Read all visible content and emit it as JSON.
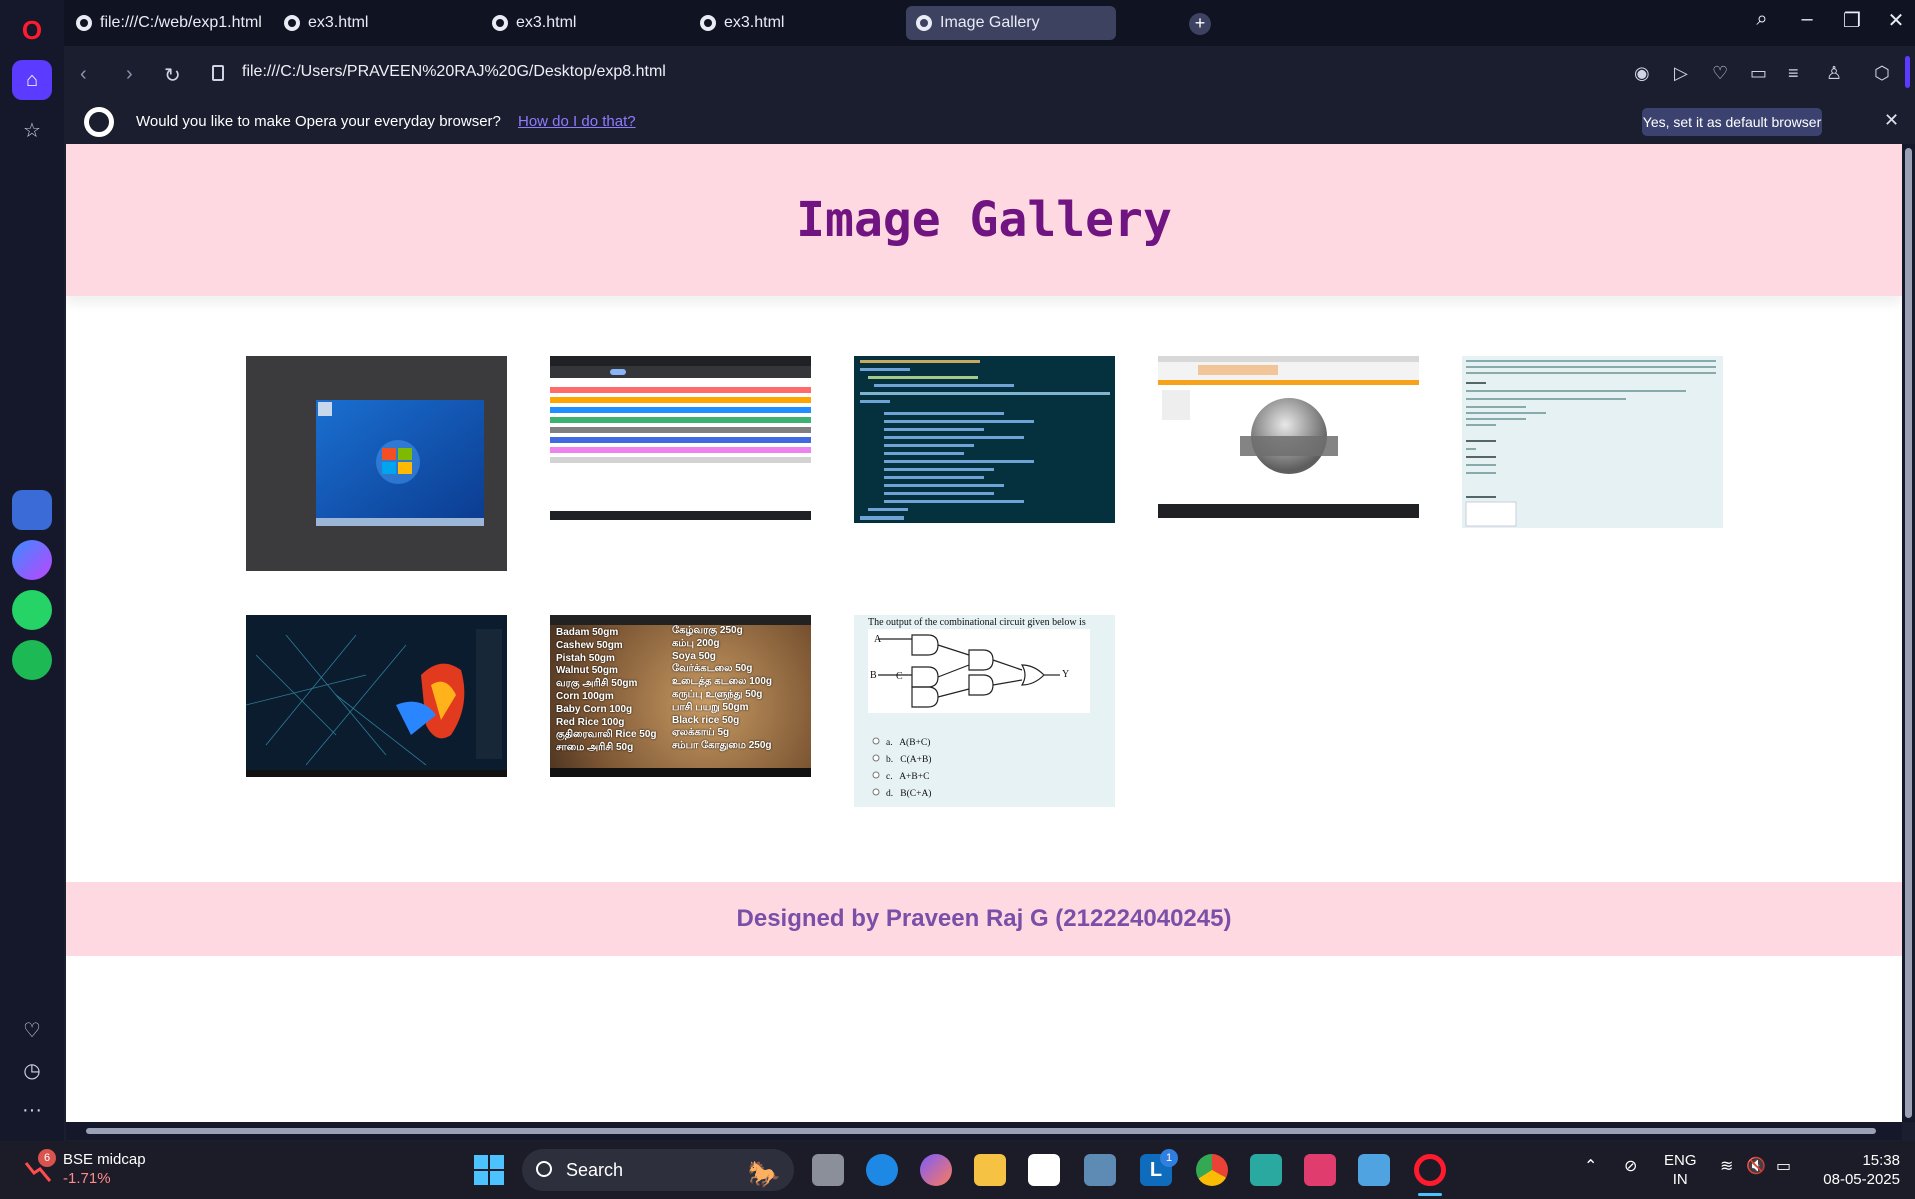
{
  "browser": {
    "tabs": [
      {
        "label": "file:///C:/web/exp1.html",
        "active": false
      },
      {
        "label": "ex3.html",
        "active": false
      },
      {
        "label": "ex3.html",
        "active": false
      },
      {
        "label": "ex3.html",
        "active": false
      },
      {
        "label": "Image Gallery",
        "active": true
      }
    ],
    "url": "file:///C:/Users/PRAVEEN%20RAJ%20G/Desktop/exp8.html",
    "infobar": {
      "message": "Would you like to make Opera your everyday browser?",
      "link": "How do I do that?",
      "button": "Yes, set it as default browser"
    }
  },
  "page": {
    "title": "Image Gallery",
    "footer": "Designed by Praveen Raj G (212224040245)",
    "images": [
      {
        "caption": "desktop screenshot"
      },
      {
        "caption": "color list"
      },
      {
        "caption": "xml code"
      },
      {
        "caption": "3d sphere"
      },
      {
        "caption": "problem statement"
      },
      {
        "caption": "parrot wallpaper"
      },
      {
        "caption": "grains list"
      },
      {
        "caption": "circuit question"
      }
    ],
    "grains_left": [
      "Badam 50gm",
      "Cashew 50gm",
      "Pistah 50gm",
      "Walnut 50gm",
      "வரகு அரிசி 50gm",
      "Corn 100gm",
      "Baby Corn 100g",
      "Red Rice 100g",
      "குதிரைவாலி Rice 50g",
      "சாமை அரிசி 50g"
    ],
    "grains_right": [
      "கேழ்வரகு 250g",
      "கம்பு 200g",
      "Soya 50g",
      "வேர்க்கடலை 50g",
      "உடைத்த கடலை 100g",
      "கருப்பு உளுந்து 50g",
      "பாசி பயறு 50gm",
      "Black rice 50g",
      "ஏலக்காய் 5g",
      "சம்பா கோதுமை 250g"
    ],
    "circuit_question": "The output of the combinational circuit given below is",
    "circuit_options": [
      "a.   A(B+C)",
      "b.   C(A+B)",
      "c.   A+B+C",
      "d.   B(C+A)"
    ]
  },
  "taskbar": {
    "widget_title": "BSE midcap",
    "widget_value": "-1.71%",
    "widget_badge": "6",
    "search_placeholder": "Search",
    "lang_top": "ENG",
    "lang_bottom": "IN",
    "time": "15:38",
    "date": "08-05-2025",
    "outlook_badge": "1"
  }
}
